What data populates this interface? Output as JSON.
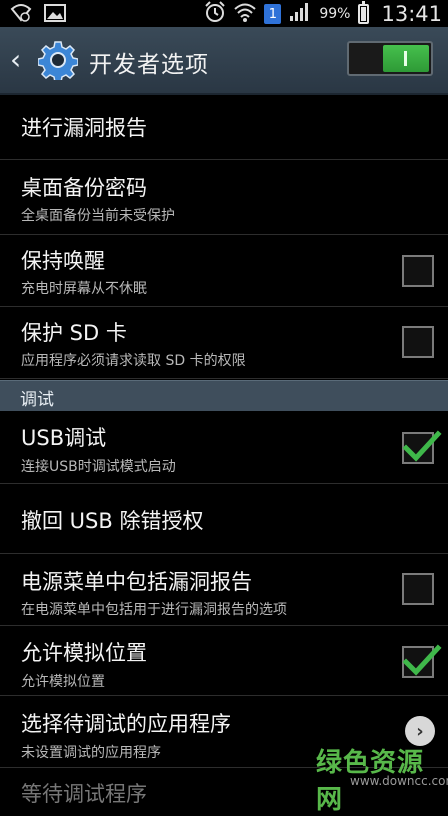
{
  "status_bar": {
    "left_icons": [
      "wifi-call-icon",
      "image-icon"
    ],
    "right_icons": [
      "alarm-icon",
      "wifi-icon"
    ],
    "sim_badge": "1",
    "battery_percent": "99%",
    "battery_level": 0.99,
    "time": "13:41"
  },
  "action_bar": {
    "back_icon": "back-chevron-icon",
    "app_icon": "settings-gear-icon",
    "title": "开发者选项",
    "master_switch_on": true
  },
  "items": [
    {
      "title": "进行漏洞报告",
      "subtitle": "",
      "control": "none"
    },
    {
      "title": "桌面备份密码",
      "subtitle": "全桌面备份当前未受保护",
      "control": "none"
    },
    {
      "title": "保持唤醒",
      "subtitle": "充电时屏幕从不休眠",
      "control": "checkbox",
      "checked": false
    },
    {
      "title": "保护 SD 卡",
      "subtitle": "应用程序必须请求读取 SD 卡的权限",
      "control": "checkbox",
      "checked": false
    }
  ],
  "section": {
    "label": "调试"
  },
  "debug_items": [
    {
      "title": "USB调试",
      "subtitle": "连接USB时调试模式启动",
      "control": "checkbox",
      "checked": true
    },
    {
      "title": "撤回 USB 除错授权",
      "subtitle": "",
      "control": "none"
    },
    {
      "title": "电源菜单中包括漏洞报告",
      "subtitle": "在电源菜单中包括用于进行漏洞报告的选项",
      "control": "checkbox",
      "checked": false
    },
    {
      "title": "允许模拟位置",
      "subtitle": "允许模拟位置",
      "control": "checkbox",
      "checked": true
    },
    {
      "title": "选择待调试的应用程序",
      "subtitle": "未设置调试的应用程序",
      "control": "chevron"
    },
    {
      "title": "等待调试程序",
      "subtitle": "",
      "control": "none"
    }
  ],
  "watermark": {
    "text": "绿色资源网",
    "url": "www.downcc.com"
  },
  "colors": {
    "accent_green": "#3fb84a",
    "header_bg": "#3f4e5c"
  }
}
